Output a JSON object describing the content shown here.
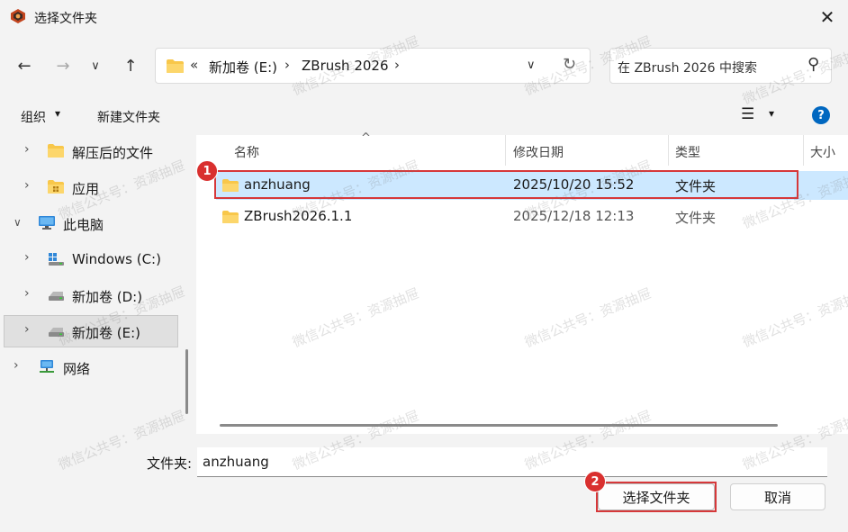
{
  "window": {
    "title": "选择文件夹",
    "close_glyph": "✕"
  },
  "nav": {
    "back_glyph": "←",
    "forward_glyph": "→",
    "recent_glyph": "∨",
    "up_glyph": "↑"
  },
  "address": {
    "overflow": "«",
    "crumbs": [
      "新加卷 (E:)",
      "ZBrush 2026"
    ],
    "sep": "›",
    "dropdown_glyph": "∨",
    "refresh_glyph": "↻"
  },
  "search": {
    "placeholder": "在 ZBrush 2026 中搜索",
    "icon_glyph": "⚲"
  },
  "toolbar": {
    "organize": "组织",
    "organize_arrow": "▾",
    "new_folder": "新建文件夹",
    "view_glyph": "☰",
    "view_arrow": "▾",
    "help_glyph": "?"
  },
  "sidebar": {
    "items": [
      {
        "label": "解压后的文件",
        "chev": "›"
      },
      {
        "label": "应用",
        "chev": "›"
      },
      {
        "label": "此电脑",
        "chev": "∨"
      },
      {
        "label": "Windows (C:)",
        "chev": "›"
      },
      {
        "label": "新加卷 (D:)",
        "chev": "›"
      },
      {
        "label": "新加卷 (E:)",
        "chev": "›"
      },
      {
        "label": "网络",
        "chev": "›"
      }
    ]
  },
  "list": {
    "sort_glyph": "^",
    "columns": [
      "名称",
      "修改日期",
      "类型",
      "大小"
    ],
    "rows": [
      {
        "name": "anzhuang",
        "date": "2025/10/20 15:52",
        "type": "文件夹"
      },
      {
        "name": "ZBrush2026.1.1",
        "date": "2025/12/18 12:13",
        "type": "文件夹"
      }
    ]
  },
  "footer": {
    "folder_label": "文件夹:",
    "folder_value": "anzhuang",
    "select_button": "选择文件夹",
    "cancel_button": "取消"
  },
  "annotations": {
    "badge1": "1",
    "badge2": "2"
  },
  "watermark": "微信公共号：资源抽屉",
  "colors": {
    "accent": "#0067c0",
    "selection": "#cce8ff",
    "annotation_red": "#d6383a",
    "folder_yellow": "#f8c74a"
  }
}
